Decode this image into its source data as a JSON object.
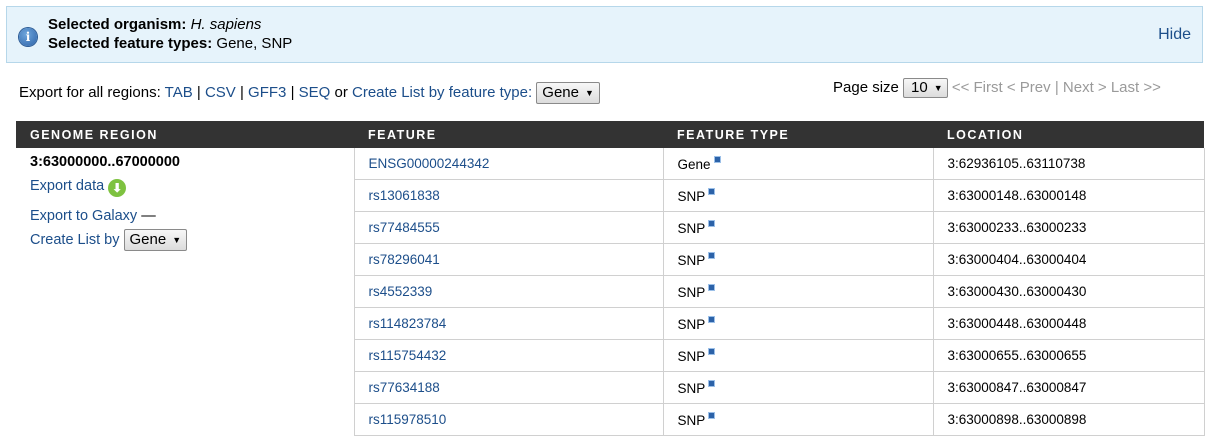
{
  "info": {
    "organism_label": "Selected organism:",
    "organism_value": "H. sapiens",
    "types_label": "Selected feature types:",
    "types_value": "Gene, SNP",
    "hide": "Hide"
  },
  "export_bar": {
    "prefix": "Export for all regions:",
    "tab": "TAB",
    "csv": "CSV",
    "gff3": "GFF3",
    "seq": "SEQ",
    "or": "or",
    "create_list": "Create List by feature type:",
    "select_value": "Gene"
  },
  "pager": {
    "label": "Page size",
    "size": "10",
    "first": "<< First",
    "prev": "< Prev",
    "next": "Next >",
    "last": "Last >>"
  },
  "table": {
    "headers": [
      "GENOME REGION",
      "FEATURE",
      "FEATURE TYPE",
      "LOCATION"
    ],
    "region": {
      "title": "3:63000000..67000000",
      "export_data": "Export data",
      "export_galaxy": "Export to Galaxy",
      "galaxy_dash": "—",
      "create_list": "Create List by",
      "select_value": "Gene"
    },
    "rows": [
      {
        "feature": "ENSG00000244342",
        "type": "Gene",
        "location": "3:62936105..63110738"
      },
      {
        "feature": "rs13061838",
        "type": "SNP",
        "location": "3:63000148..63000148"
      },
      {
        "feature": "rs77484555",
        "type": "SNP",
        "location": "3:63000233..63000233"
      },
      {
        "feature": "rs78296041",
        "type": "SNP",
        "location": "3:63000404..63000404"
      },
      {
        "feature": "rs4552339",
        "type": "SNP",
        "location": "3:63000430..63000430"
      },
      {
        "feature": "rs114823784",
        "type": "SNP",
        "location": "3:63000448..63000448"
      },
      {
        "feature": "rs115754432",
        "type": "SNP",
        "location": "3:63000655..63000655"
      },
      {
        "feature": "rs77634188",
        "type": "SNP",
        "location": "3:63000847..63000847"
      },
      {
        "feature": "rs115978510",
        "type": "SNP",
        "location": "3:63000898..63000898"
      }
    ]
  },
  "icons": {
    "info": "info-icon",
    "download": "download-arrow-icon",
    "type_info": "info-badge-icon"
  }
}
